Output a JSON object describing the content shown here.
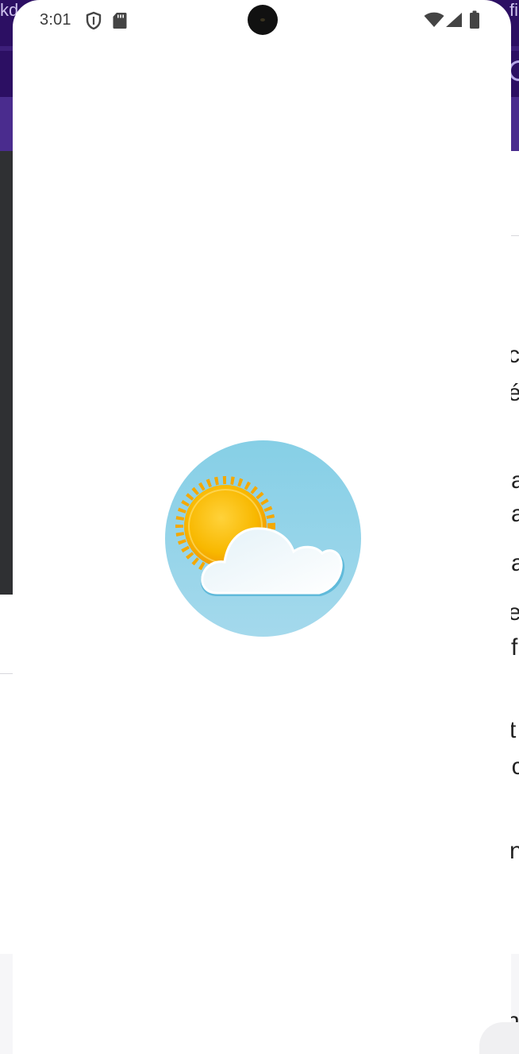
{
  "status_bar": {
    "time": "3:01",
    "left_icons": [
      "shield-icon",
      "sd-card-icon"
    ],
    "right_icons": [
      "wifi-icon",
      "cell-signal-icon",
      "battery-icon"
    ]
  },
  "splash": {
    "logo_icon": "partly-cloudy-weather-icon",
    "logo_background": "#8ccfe6",
    "sun_color": "#f7b500",
    "cloud_color": "#eef7fb"
  },
  "background_app": {
    "top_left_fragment": "kd",
    "top_right_fragment": "fi",
    "right_text_fragments": [
      "c",
      "é",
      "a",
      "a",
      "a",
      "e",
      "f",
      "t",
      "ic",
      "n",
      "n"
    ],
    "accent_color": "#2c0f63"
  }
}
